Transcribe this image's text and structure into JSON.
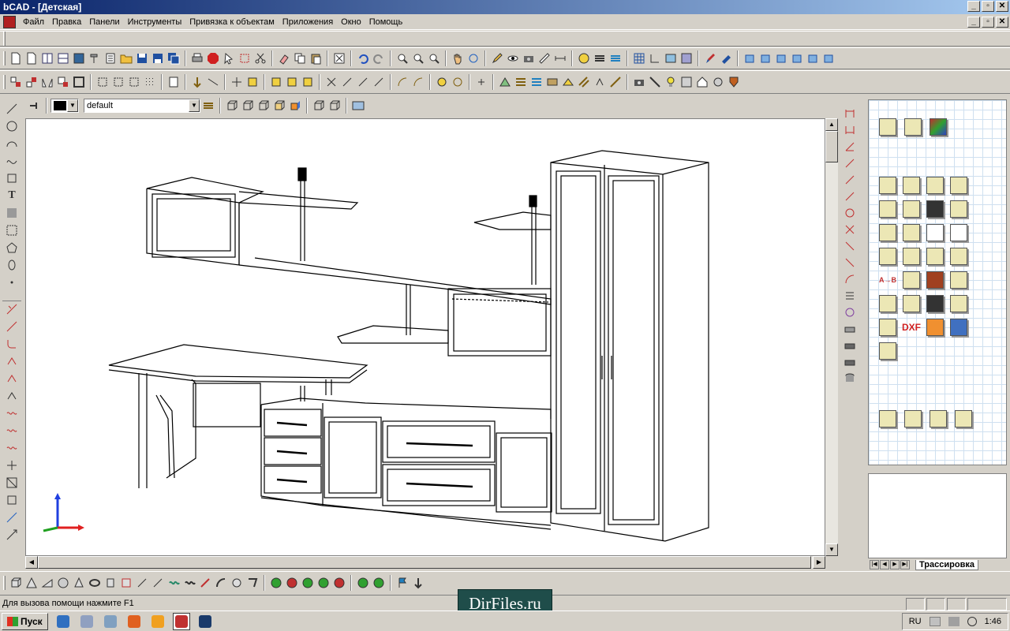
{
  "window": {
    "title": "bCAD - [Детская]"
  },
  "menu": {
    "items": [
      "Файл",
      "Правка",
      "Панели",
      "Инструменты",
      "Привязка к объектам",
      "Приложения",
      "Окно",
      "Помощь"
    ]
  },
  "window_controls": {
    "minimize": "_",
    "maximize": "▫",
    "close": "✕"
  },
  "layer_bar": {
    "color": "#000000",
    "layer_value": "default"
  },
  "status": {
    "help_text": "Для вызова помощи нажмите F1"
  },
  "right_panel": {
    "tab_label": "Трассировка",
    "icon_labels": {
      "ab": "A→B",
      "dxf": "DXF"
    }
  },
  "watermark": {
    "text": "DirFiles.ru"
  },
  "taskbar": {
    "start_label": "Пуск",
    "lang": "RU",
    "time": "1:46"
  },
  "axis_colors": {
    "x": "#e02020",
    "y": "#20a020",
    "z": "#2040e0"
  }
}
